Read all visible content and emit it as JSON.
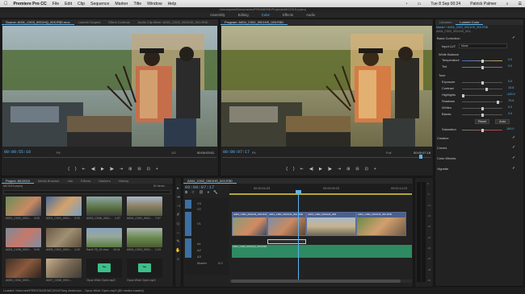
{
  "menubar": {
    "apple": "",
    "app": "Premiere Pro CC",
    "items": [
      "File",
      "Edit",
      "Clip",
      "Sequence",
      "Marker",
      "Title",
      "Window",
      "Help"
    ],
    "time": "Tue 8 Sep 00:24",
    "user": "Patrick Palmer"
  },
  "titlebar": "/Users/pam/Documents/PREMIERE/Projects/MC2015.prproj",
  "workspaces": [
    "Assembly",
    "Editing",
    "Color",
    "Effects",
    "Audio",
    "Libraries"
  ],
  "source": {
    "tabs": [
      "Source: A001_C003_0921HQ_003.R3D.mov",
      "Lumetri Scopes",
      "Effect Controls",
      "Audio Clip Mixer: A001_C002_0921HS_001.R3D"
    ],
    "tc_in": "00:00:55:10",
    "fit": "Fit",
    "ratio": "1/2",
    "tc_out": "00:00:03:01"
  },
  "program": {
    "tabs": [
      "Program: A004_C002_0921HS_003.R3D"
    ],
    "tc_in": "00:00:07:17",
    "fit": "Fit",
    "ratio": "Full",
    "tc_out": "00:00:07:18"
  },
  "transport": [
    "⇤",
    "{",
    "}",
    "⇤",
    "◀|",
    "▶",
    "|▶",
    "⇥",
    "⊞",
    "⊟",
    "⊡",
    "+"
  ],
  "project": {
    "tabs": [
      "Project: MC2015",
      "Media Browser",
      "Info",
      "Effects",
      "Markers",
      "History"
    ],
    "file": "MC2015.prproj",
    "count": "81 items",
    "clips": [
      {
        "name": "A001_C002_0921...",
        "dur": "4:20"
      },
      {
        "name": "A001_C001_0921...",
        "dur": "3:23"
      },
      {
        "name": "A003_C006_0921...",
        "dur": "1:07"
      },
      {
        "name": "A004_C002_0921...",
        "dur": "7:07"
      },
      {
        "name": "A004_C008_0921...",
        "dur": "3:00"
      },
      {
        "name": "A005_C001_0921...",
        "dur": "1:22"
      },
      {
        "name": "Earth 75_01.mov",
        "dur": "10:11"
      },
      {
        "name": "A004_C003_0921...",
        "dur": "1:23"
      },
      {
        "name": "A005_C004_0921...",
        "dur": "4:19"
      },
      {
        "name": "A007_C006_0921...",
        "dur": "1:07"
      },
      {
        "name": "Opus Wide Open.mp3",
        "dur": ""
      },
      {
        "name": "Opus Wide Open.mp3",
        "dur": ""
      }
    ]
  },
  "timeline": {
    "tab": "A004_C002_0921HS_003.R3D",
    "tc": "00:00:07:17",
    "ruler": [
      "00:00:04:23",
      "00:00:09:23",
      "00:00:14:23"
    ],
    "tracks": [
      "V3",
      "V2",
      "V1",
      "A1",
      "A2",
      "A3",
      "Master"
    ],
    "master_val": "0.0",
    "clips": [
      "A004_C002_0921HS_003.R3D",
      "A001_C002_0921HS_001.R3D",
      "A004_C002_0921HS_003",
      "A001_C002_0921HS_001.R3D",
      "A001_C003_0921HQ_003.R3D"
    ]
  },
  "lumetri": {
    "tabs": [
      "Libraries",
      "Lumetri Color"
    ],
    "master": "Master * A004_C002_0921HS_003.R3D",
    "seq": "A004_C002_0921HS_003...",
    "basic": "Basic Correction",
    "input_lut": "Input LUT",
    "lut_value": "None",
    "wb": "White Balance",
    "rows": [
      {
        "name": "Temperature",
        "val": "0.0"
      },
      {
        "name": "Tint",
        "val": "0.0"
      }
    ],
    "tone": "Tone",
    "tone_rows": [
      {
        "name": "Exposure",
        "val": "0.0"
      },
      {
        "name": "Contrast",
        "val": "15.8"
      },
      {
        "name": "Highlights",
        "val": "-100.0"
      },
      {
        "name": "Shadows",
        "val": "75.6"
      },
      {
        "name": "Whites",
        "val": "0.0"
      },
      {
        "name": "Blacks",
        "val": "0.0"
      }
    ],
    "reset": "Reset",
    "auto": "Auto",
    "saturation": "Saturation",
    "sat_val": "100.0",
    "sections": [
      "Creative",
      "Curves",
      "Color Wheels",
      "Vignette"
    ]
  },
  "status": "Loaded /Volumes/PRESTAGE/MC2015/Tony Anderson - Opus Wide Open.mp3 (80 media loaded)",
  "vu": [
    "0",
    "-6",
    "-12",
    "-18",
    "-24",
    "-30",
    "-36",
    "-42",
    "-48",
    "-54"
  ]
}
